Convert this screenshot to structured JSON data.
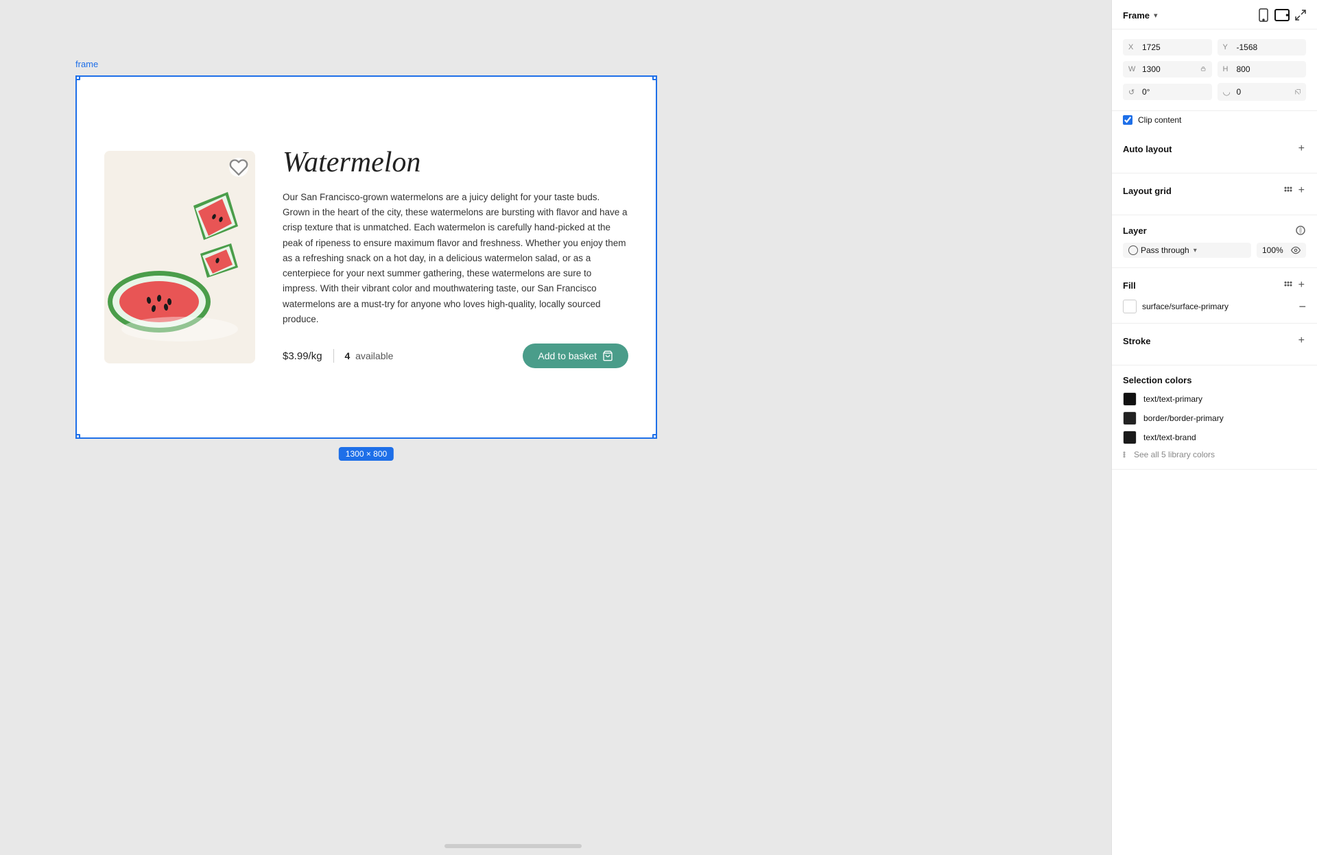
{
  "canvas": {
    "background": "#e8e8e8",
    "frame_label": "frame",
    "frame_size_badge": "1300 × 800"
  },
  "product": {
    "title": "Watermelon",
    "description": "Our San Francisco-grown watermelons are a juicy delight for your taste buds. Grown in the heart of the city, these watermelons are bursting with flavor and have a crisp texture that is unmatched. Each watermelon is carefully hand-picked at the peak of ripeness to ensure maximum flavor and freshness. Whether you enjoy them as a refreshing snack on a hot day, in a delicious watermelon salad, or as a centerpiece for your next summer gathering, these watermelons are sure to impress. With their vibrant color and mouthwatering taste, our San Francisco watermelons are a must-try for anyone who loves high-quality, locally sourced produce.",
    "price": "$3.99/kg",
    "available_count": "4",
    "available_label": "available",
    "button_label": "Add to basket"
  },
  "panel": {
    "frame_title": "Frame",
    "frame_chevron": "▾",
    "x_label": "X",
    "x_value": "1725",
    "y_label": "Y",
    "y_value": "-1568",
    "w_label": "W",
    "w_value": "1300",
    "h_label": "H",
    "h_value": "800",
    "rotation_label": "↺",
    "rotation_value": "0°",
    "corner_label": "◡",
    "corner_value": "0",
    "clip_content_label": "Clip content",
    "auto_layout_title": "Auto layout",
    "layout_grid_title": "Layout grid",
    "layer_title": "Layer",
    "layer_icon_title": "layer-style-icon",
    "blend_mode": "Pass through",
    "opacity_value": "100%",
    "fill_title": "Fill",
    "fill_color_name": "surface/surface-primary",
    "stroke_title": "Stroke",
    "selection_colors_title": "Selection colors",
    "colors": [
      {
        "name": "text/text-primary",
        "hex": "#111111"
      },
      {
        "name": "border/border-primary",
        "hex": "#222222"
      },
      {
        "name": "text/text-brand",
        "hex": "#1a1a1a"
      }
    ],
    "see_all_label": "See all 5 library colors"
  }
}
